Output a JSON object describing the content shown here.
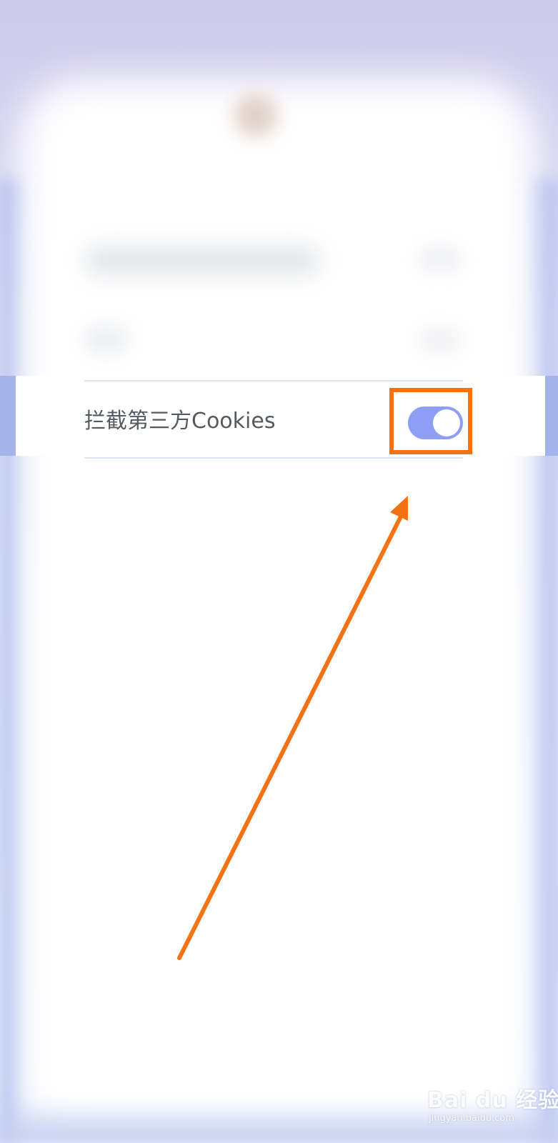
{
  "settings_row": {
    "label": "拦截第三方Cookies",
    "toggle_state": "on"
  },
  "colors": {
    "toggle_on": "#8e9ef4",
    "highlight": "#f57214",
    "label_text": "#555a62"
  },
  "watermark": {
    "logo": "Bai du 经验",
    "url": "jingyan.baidu.com"
  }
}
